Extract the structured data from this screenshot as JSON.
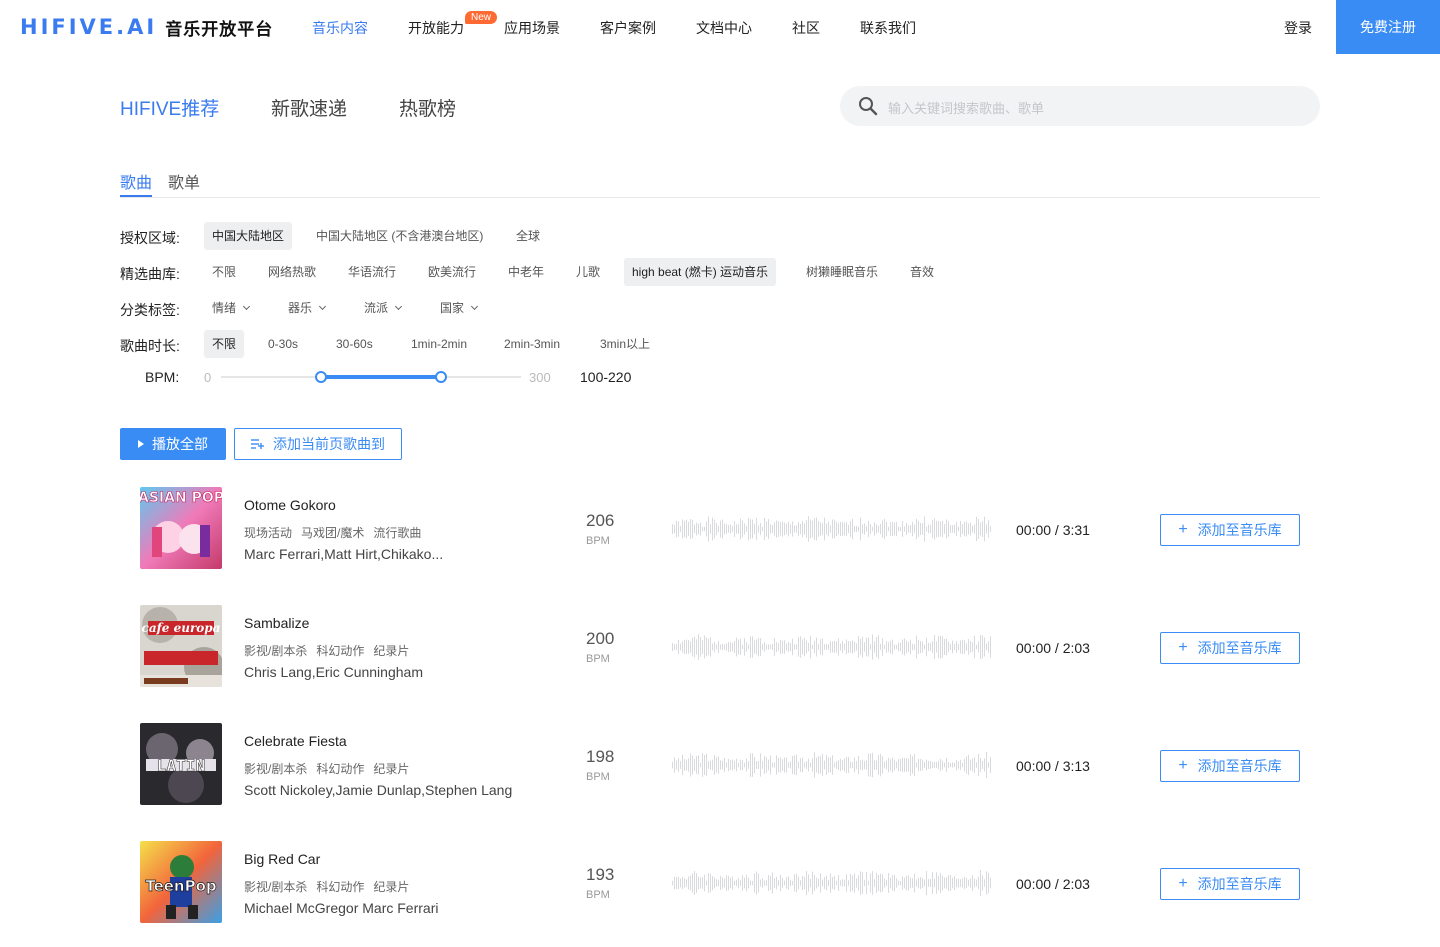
{
  "brand": {
    "logo_text": "HIFIVE.AI",
    "logo_cn": "音乐开放平台"
  },
  "nav": {
    "items": [
      "音乐内容",
      "开放能力",
      "应用场景",
      "客户案例",
      "文档中心",
      "社区",
      "联系我们"
    ],
    "new_badge": "New",
    "login": "登录",
    "register": "免费注册"
  },
  "section_tabs": [
    "HIFIVE推荐",
    "新歌速递",
    "热歌榜"
  ],
  "search": {
    "placeholder": "输入关键词搜索歌曲、歌单"
  },
  "sub_tabs": [
    "歌曲",
    "歌单"
  ],
  "filters": {
    "region": {
      "label": "授权区域:",
      "options": [
        "中国大陆地区",
        "中国大陆地区 (不含港澳台地区)",
        "全球"
      ],
      "selected": "中国大陆地区"
    },
    "library": {
      "label": "精选曲库:",
      "options": [
        "不限",
        "网络热歌",
        "华语流行",
        "欧美流行",
        "中老年",
        "儿歌",
        "high beat (燃卡) 运动音乐",
        "树獭睡眠音乐",
        "音效"
      ],
      "selected": "high beat (燃卡) 运动音乐"
    },
    "category": {
      "label": "分类标签:",
      "options": [
        "情绪",
        "器乐",
        "流派",
        "国家"
      ]
    },
    "duration": {
      "label": "歌曲时长:",
      "options": [
        "不限",
        "0-30s",
        "30-60s",
        "1min-2min",
        "2min-3min",
        "3min以上"
      ],
      "selected": "不限"
    },
    "bpm": {
      "label": "BPM:",
      "min": "0",
      "max": "300",
      "range_low": 100,
      "range_high": 220,
      "value_text": "100-220"
    }
  },
  "actions": {
    "play_all": "播放全部",
    "add_page": "添加当前页歌曲到"
  },
  "songs": [
    {
      "title": "Otome Gokoro",
      "tags": [
        "现场活动",
        "马戏团/魔术",
        "流行歌曲"
      ],
      "artist": "Marc Ferrari,Matt Hirt,Chikako...",
      "bpm": "206",
      "bpm_unit": "BPM",
      "time": "00:00 / 3:31",
      "add": "添加至音乐库",
      "cover_text": "ASIAN POP"
    },
    {
      "title": "Sambalize",
      "tags": [
        "影视/剧本杀",
        "科幻动作",
        "纪录片"
      ],
      "artist": "Chris Lang,Eric Cunningham",
      "bpm": "200",
      "bpm_unit": "BPM",
      "time": "00:00 / 2:03",
      "add": "添加至音乐库",
      "cover_text": "cafe europa"
    },
    {
      "title": "Celebrate Fiesta",
      "tags": [
        "影视/剧本杀",
        "科幻动作",
        "纪录片"
      ],
      "artist": "Scott Nickoley,Jamie Dunlap,Stephen Lang",
      "bpm": "198",
      "bpm_unit": "BPM",
      "time": "00:00 / 3:13",
      "add": "添加至音乐库",
      "cover_text": "LATIN"
    },
    {
      "title": "Big Red Car",
      "tags": [
        "影视/剧本杀",
        "科幻动作",
        "纪录片"
      ],
      "artist": "Michael McGregor Marc Ferrari",
      "bpm": "193",
      "bpm_unit": "BPM",
      "time": "00:00 / 2:03",
      "add": "添加至音乐库",
      "cover_text": "TeenPop"
    }
  ],
  "colors": {
    "accent": "#3a8cf5",
    "brand": "#3a7bef",
    "badge": "#ff6a33"
  }
}
